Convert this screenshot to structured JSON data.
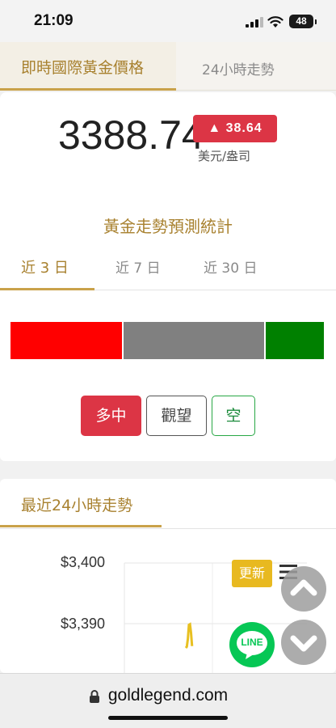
{
  "status_bar": {
    "time": "21:09",
    "battery": "48"
  },
  "price_card": {
    "tabs": [
      "即時國際黃金價格",
      "24小時走勢"
    ],
    "price": "3388.74",
    "change": "▲ 38.64",
    "unit": "美元/盎司",
    "colors": {
      "accent": "#c9a24a",
      "down_badge": "#dc3545"
    }
  },
  "forecast_card": {
    "title": "黃金走勢預測統計",
    "tabs": [
      "近 3 日",
      "近 7 日",
      "近 30 日"
    ],
    "bar_segments": [
      {
        "name": "多",
        "fraction": 0.36,
        "color": "#ff0000"
      },
      {
        "name": "觀望",
        "fraction": 0.45,
        "color": "#808080"
      },
      {
        "name": "空",
        "fraction": 0.19,
        "color": "#008000"
      }
    ],
    "buttons": {
      "long": "多中",
      "watch": "觀望",
      "short": "空"
    }
  },
  "trend_card": {
    "title": "最近24小時走勢",
    "y_ticks": [
      "$3,400",
      "$3,390"
    ],
    "update_label": "更新",
    "line_label": "LINE"
  },
  "chart_data": {
    "type": "line",
    "ylim": [
      3385,
      3400
    ],
    "y_ticks": [
      3400,
      3390
    ],
    "series": [
      {
        "values": [
          3386.0,
          3386.2,
          3387.5,
          3389.8,
          3389.9,
          3388.5,
          3386.3
        ]
      }
    ]
  },
  "browser": {
    "url": "goldlegend.com"
  }
}
